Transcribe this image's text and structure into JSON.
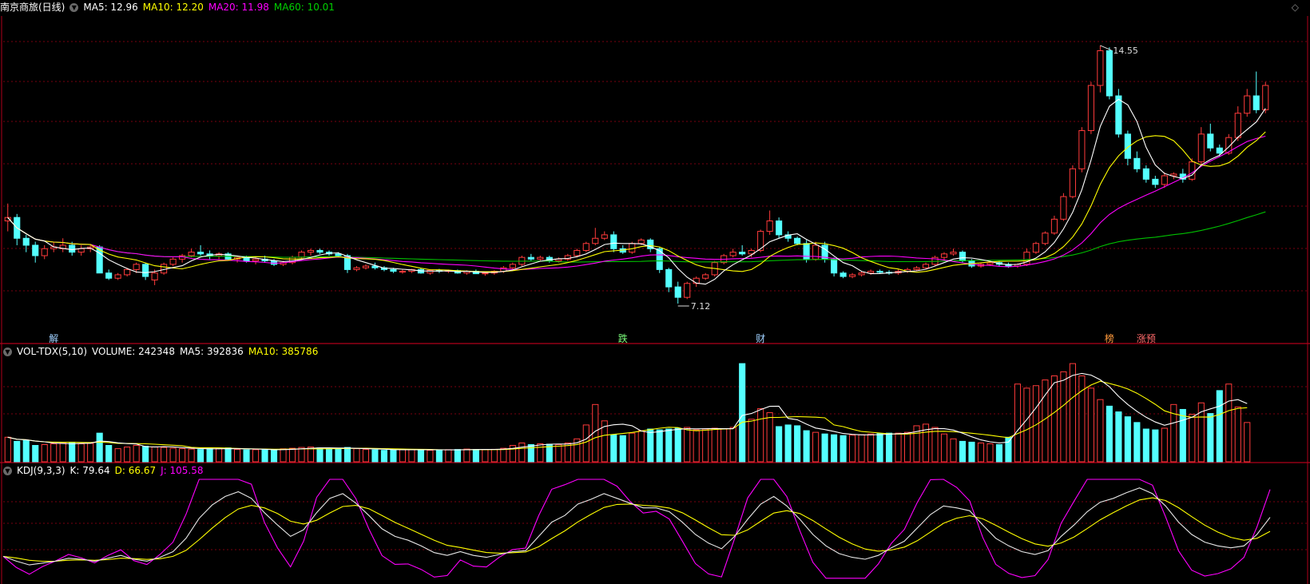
{
  "header_main": {
    "title": "南京商旅(日线)",
    "ma5": "MA5: 12.96",
    "ma10": "MA10: 12.20",
    "ma20": "MA20: 11.98",
    "ma60": "MA60: 10.01"
  },
  "header_vol": {
    "title": "VOL-TDX(5,10)",
    "volume": "VOLUME: 242348",
    "ma5": "MA5: 392836",
    "ma10": "MA10: 385786"
  },
  "header_kdj": {
    "title": "KDJ(9,3,3)",
    "k": "K: 79.64",
    "d": "D: 66.67",
    "j": "J: 105.58"
  },
  "colors": {
    "up": "#ff3b3b",
    "down": "#54ffff",
    "ma5": "#ffffff",
    "ma10": "#ffff00",
    "ma20": "#ff00ff",
    "ma60": "#00c000",
    "divider": "#b0001a"
  },
  "chart_data": [
    {
      "type": "candlestick",
      "panel": "price",
      "high_label": "14.55",
      "low_label": "7.12",
      "markers": [
        {
          "index": 5,
          "text": "解",
          "color": "#9fd0ff"
        },
        {
          "index": 67,
          "text": "跌",
          "color": "#7cff7c"
        },
        {
          "index": 82,
          "text": "财",
          "color": "#9fd0ff"
        },
        {
          "index": 120,
          "text": "榜",
          "color": "#ff9a3c"
        },
        {
          "index": 124,
          "text": "涨预",
          "color": "#ff6a6a"
        }
      ],
      "candles": [
        [
          9.5,
          10.0,
          9.2,
          9.6
        ],
        [
          9.6,
          9.7,
          8.8,
          9.0
        ],
        [
          9.0,
          9.1,
          8.6,
          8.8
        ],
        [
          8.8,
          8.9,
          8.3,
          8.5
        ],
        [
          8.5,
          8.8,
          8.4,
          8.7
        ],
        [
          8.7,
          8.9,
          8.6,
          8.75
        ],
        [
          8.7,
          9.0,
          8.6,
          8.8
        ],
        [
          8.8,
          8.9,
          8.5,
          8.6
        ],
        [
          8.6,
          8.8,
          8.5,
          8.7
        ],
        [
          8.7,
          8.8,
          8.6,
          8.75
        ],
        [
          8.75,
          8.8,
          8.0,
          8.0
        ],
        [
          8.0,
          8.1,
          7.8,
          7.85
        ],
        [
          7.85,
          8.0,
          7.8,
          7.95
        ],
        [
          7.95,
          8.15,
          7.9,
          8.1
        ],
        [
          8.1,
          8.3,
          8.0,
          8.25
        ],
        [
          8.25,
          8.3,
          7.8,
          7.9
        ],
        [
          7.8,
          8.1,
          7.65,
          8.0
        ],
        [
          8.0,
          8.3,
          7.95,
          8.25
        ],
        [
          8.25,
          8.45,
          8.2,
          8.4
        ],
        [
          8.4,
          8.55,
          8.3,
          8.5
        ],
        [
          8.5,
          8.7,
          8.45,
          8.6
        ],
        [
          8.6,
          8.8,
          8.5,
          8.55
        ],
        [
          8.55,
          8.65,
          8.4,
          8.5
        ],
        [
          8.5,
          8.6,
          8.4,
          8.55
        ],
        [
          8.55,
          8.6,
          8.35,
          8.4
        ],
        [
          8.4,
          8.5,
          8.3,
          8.45
        ],
        [
          8.45,
          8.5,
          8.3,
          8.35
        ],
        [
          8.35,
          8.45,
          8.25,
          8.4
        ],
        [
          8.4,
          8.5,
          8.3,
          8.35
        ],
        [
          8.35,
          8.4,
          8.2,
          8.25
        ],
        [
          8.25,
          8.35,
          8.2,
          8.3
        ],
        [
          8.3,
          8.5,
          8.25,
          8.45
        ],
        [
          8.45,
          8.65,
          8.4,
          8.6
        ],
        [
          8.6,
          8.7,
          8.5,
          8.65
        ],
        [
          8.65,
          8.7,
          8.55,
          8.6
        ],
        [
          8.6,
          8.65,
          8.5,
          8.55
        ],
        [
          8.55,
          8.6,
          8.45,
          8.5
        ],
        [
          8.5,
          8.55,
          8.0,
          8.1
        ],
        [
          8.1,
          8.2,
          8.05,
          8.15
        ],
        [
          8.15,
          8.25,
          8.1,
          8.2
        ],
        [
          8.2,
          8.3,
          8.1,
          8.15
        ],
        [
          8.15,
          8.2,
          8.05,
          8.1
        ],
        [
          8.1,
          8.15,
          8.0,
          8.05
        ],
        [
          8.05,
          8.1,
          7.98,
          8.05
        ],
        [
          8.05,
          8.12,
          8.0,
          8.1
        ],
        [
          8.1,
          8.15,
          7.98,
          8.0
        ],
        [
          8.0,
          8.1,
          7.95,
          8.08
        ],
        [
          8.08,
          8.12,
          8.0,
          8.05
        ],
        [
          8.05,
          8.1,
          8.0,
          8.07
        ],
        [
          8.07,
          8.1,
          7.98,
          8.0
        ],
        [
          8.0,
          8.08,
          7.95,
          8.05
        ],
        [
          8.05,
          8.1,
          7.98,
          7.98
        ],
        [
          7.98,
          8.05,
          7.92,
          8.0
        ],
        [
          8.0,
          8.08,
          7.95,
          8.05
        ],
        [
          8.05,
          8.2,
          8.0,
          8.15
        ],
        [
          8.15,
          8.3,
          8.1,
          8.25
        ],
        [
          8.25,
          8.5,
          8.2,
          8.45
        ],
        [
          8.45,
          8.55,
          8.35,
          8.4
        ],
        [
          8.4,
          8.5,
          8.35,
          8.45
        ],
        [
          8.45,
          8.5,
          8.3,
          8.35
        ],
        [
          8.35,
          8.45,
          8.3,
          8.4
        ],
        [
          8.4,
          8.55,
          8.35,
          8.5
        ],
        [
          8.5,
          8.7,
          8.45,
          8.65
        ],
        [
          8.65,
          8.9,
          8.6,
          8.85
        ],
        [
          8.85,
          9.3,
          8.8,
          9.0
        ],
        [
          9.0,
          9.2,
          8.95,
          9.1
        ],
        [
          9.1,
          9.2,
          8.6,
          8.7
        ],
        [
          8.7,
          8.8,
          8.55,
          8.6
        ],
        [
          8.6,
          8.9,
          8.55,
          8.85
        ],
        [
          8.85,
          9.0,
          8.8,
          8.95
        ],
        [
          8.95,
          9.0,
          8.6,
          8.7
        ],
        [
          8.7,
          8.75,
          8.0,
          8.1
        ],
        [
          8.1,
          8.15,
          7.45,
          7.6
        ],
        [
          7.6,
          7.75,
          7.12,
          7.3
        ],
        [
          7.3,
          7.75,
          7.25,
          7.7
        ],
        [
          7.7,
          7.9,
          7.6,
          7.85
        ],
        [
          7.85,
          8.0,
          7.8,
          7.95
        ],
        [
          7.95,
          8.35,
          7.9,
          8.3
        ],
        [
          8.3,
          8.55,
          8.25,
          8.5
        ],
        [
          8.5,
          8.7,
          8.45,
          8.6
        ],
        [
          8.6,
          8.8,
          8.5,
          8.55
        ],
        [
          8.55,
          8.7,
          8.45,
          8.65
        ],
        [
          8.65,
          9.25,
          8.6,
          9.2
        ],
        [
          9.2,
          9.8,
          9.1,
          9.5
        ],
        [
          9.5,
          9.6,
          9.0,
          9.1
        ],
        [
          9.1,
          9.2,
          8.9,
          9.0
        ],
        [
          9.0,
          9.05,
          8.8,
          8.85
        ],
        [
          8.85,
          8.95,
          8.3,
          8.4
        ],
        [
          8.4,
          8.9,
          8.35,
          8.8
        ],
        [
          8.8,
          8.9,
          8.3,
          8.4
        ],
        [
          8.4,
          8.45,
          7.9,
          8.0
        ],
        [
          8.0,
          8.05,
          7.85,
          7.9
        ],
        [
          7.9,
          8.0,
          7.85,
          7.95
        ],
        [
          7.95,
          8.05,
          7.9,
          8.0
        ],
        [
          8.0,
          8.1,
          7.95,
          8.05
        ],
        [
          8.05,
          8.1,
          7.98,
          8.02
        ],
        [
          8.02,
          8.08,
          7.95,
          8.0
        ],
        [
          8.0,
          8.1,
          7.95,
          8.05
        ],
        [
          8.05,
          8.15,
          8.0,
          8.1
        ],
        [
          8.1,
          8.2,
          8.05,
          8.15
        ],
        [
          8.15,
          8.3,
          8.1,
          8.25
        ],
        [
          8.25,
          8.5,
          8.2,
          8.45
        ],
        [
          8.45,
          8.6,
          8.35,
          8.55
        ],
        [
          8.55,
          8.7,
          8.5,
          8.6
        ],
        [
          8.6,
          8.65,
          8.3,
          8.35
        ],
        [
          8.35,
          8.4,
          8.15,
          8.2
        ],
        [
          8.2,
          8.3,
          8.15,
          8.25
        ],
        [
          8.25,
          8.35,
          8.2,
          8.3
        ],
        [
          8.3,
          8.35,
          8.2,
          8.25
        ],
        [
          8.25,
          8.3,
          8.15,
          8.2
        ],
        [
          8.2,
          8.28,
          8.15,
          8.25
        ],
        [
          8.25,
          8.7,
          8.2,
          8.6
        ],
        [
          8.6,
          8.9,
          8.55,
          8.85
        ],
        [
          8.85,
          9.2,
          8.8,
          9.15
        ],
        [
          9.15,
          9.65,
          9.1,
          9.55
        ],
        [
          9.55,
          10.3,
          9.5,
          10.2
        ],
        [
          10.2,
          11.1,
          10.15,
          11.0
        ],
        [
          11.0,
          12.2,
          10.9,
          12.1
        ],
        [
          12.1,
          13.5,
          12.0,
          13.4
        ],
        [
          13.4,
          14.55,
          13.2,
          14.4
        ],
        [
          14.4,
          14.5,
          13.0,
          13.1
        ],
        [
          13.1,
          13.3,
          11.9,
          12.0
        ],
        [
          12.0,
          12.1,
          11.1,
          11.3
        ],
        [
          11.3,
          11.5,
          10.9,
          11.0
        ],
        [
          11.0,
          11.1,
          10.6,
          10.7
        ],
        [
          10.7,
          10.8,
          10.45,
          10.55
        ],
        [
          10.55,
          10.9,
          10.45,
          10.8
        ],
        [
          10.8,
          10.9,
          10.7,
          10.85
        ],
        [
          10.85,
          11.0,
          10.6,
          10.7
        ],
        [
          10.7,
          11.3,
          10.65,
          11.2
        ],
        [
          11.2,
          12.2,
          11.1,
          12.0
        ],
        [
          12.0,
          12.3,
          11.5,
          11.6
        ],
        [
          11.6,
          11.7,
          11.35,
          11.45
        ],
        [
          11.45,
          12.0,
          11.4,
          11.9
        ],
        [
          11.9,
          12.8,
          11.8,
          12.6
        ],
        [
          12.6,
          13.3,
          12.5,
          13.1
        ],
        [
          13.1,
          13.8,
          12.6,
          12.7
        ],
        [
          12.7,
          13.5,
          12.6,
          13.4
        ]
      ]
    },
    {
      "type": "bar",
      "panel": "volume",
      "values": [
        300,
        250,
        260,
        200,
        210,
        220,
        230,
        240,
        220,
        225,
        350,
        200,
        160,
        180,
        200,
        190,
        180,
        175,
        165,
        160,
        155,
        150,
        160,
        165,
        170,
        150,
        145,
        148,
        152,
        140,
        158,
        165,
        175,
        180,
        170,
        160,
        155,
        175,
        160,
        150,
        145,
        140,
        148,
        152,
        150,
        146,
        140,
        145,
        148,
        150,
        155,
        150,
        148,
        152,
        165,
        200,
        230,
        210,
        220,
        215,
        210,
        230,
        280,
        450,
        700,
        500,
        330,
        320,
        350,
        380,
        400,
        390,
        400,
        410,
        420,
        390,
        400,
        410,
        400,
        420,
        1200,
        520,
        650,
        600,
        430,
        450,
        440,
        380,
        360,
        340,
        330,
        320,
        325,
        330,
        340,
        345,
        350,
        350,
        360,
        440,
        460,
        420,
        340,
        280,
        250,
        240,
        230,
        220,
        210,
        300,
        950,
        900,
        930,
        1000,
        1050,
        1100,
        1200,
        1050,
        900,
        760,
        680,
        610,
        550,
        480,
        400,
        390,
        410,
        700,
        640,
        580,
        720,
        590,
        870,
        950,
        670,
        480
      ]
    },
    {
      "type": "line",
      "panel": "kdj",
      "series": [
        {
          "name": "K",
          "color": "#e8e8e8",
          "values": [
            19,
            14,
            10,
            12,
            14,
            17,
            16,
            14,
            17,
            20,
            16,
            14,
            18,
            24,
            38,
            59,
            73,
            82,
            87,
            80,
            65,
            52,
            40,
            47,
            65,
            80,
            85,
            75,
            62,
            48,
            40,
            36,
            30,
            23,
            20,
            24,
            20,
            18,
            21,
            24,
            25,
            40,
            55,
            62,
            74,
            79,
            85,
            80,
            75,
            70,
            70,
            66,
            55,
            42,
            33,
            27,
            40,
            58,
            74,
            82,
            72,
            58,
            42,
            30,
            22,
            18,
            16,
            20,
            28,
            35,
            49,
            63,
            72,
            70,
            67,
            52,
            38,
            30,
            24,
            21,
            25,
            40,
            52,
            66,
            76,
            80,
            86,
            91,
            85,
            72,
            55,
            42,
            34,
            30,
            28,
            30,
            42,
            60
          ]
        }
      ]
    }
  ]
}
